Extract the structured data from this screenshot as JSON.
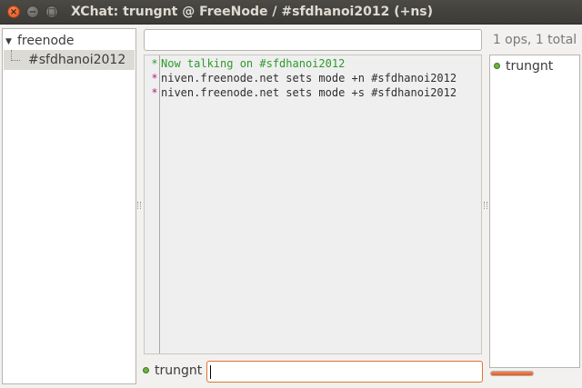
{
  "window": {
    "title": "XChat: trungnt @ FreeNode / #sfdhanoi2012 (+ns)",
    "close_glyph": "×",
    "min_glyph": "−",
    "max_glyph": "□"
  },
  "tree": {
    "server": "freenode",
    "channel": "#sfdhanoi2012"
  },
  "topic": {
    "value": ""
  },
  "userlist": {
    "count_label": "1 ops, 1 total",
    "users": [
      "trungnt"
    ]
  },
  "chat": {
    "lines": [
      {
        "prefix": "*",
        "text": "Now talking on #sfdhanoi2012",
        "color": "#2c9a2c"
      },
      {
        "prefix": "*",
        "text": "niven.freenode.net sets mode +n #sfdhanoi2012",
        "color": "#2e2e2e"
      },
      {
        "prefix": "*",
        "text": "niven.freenode.net sets mode +s #sfdhanoi2012",
        "color": "#2e2e2e"
      }
    ]
  },
  "input": {
    "nick": "trungnt",
    "value": ""
  },
  "lag_meter": {
    "level": 1.0
  },
  "colors": {
    "accent": "#e0732b",
    "op_status": "#6cb33f",
    "join_message": "#2c9a2c",
    "prefix": "#b01f7e"
  }
}
